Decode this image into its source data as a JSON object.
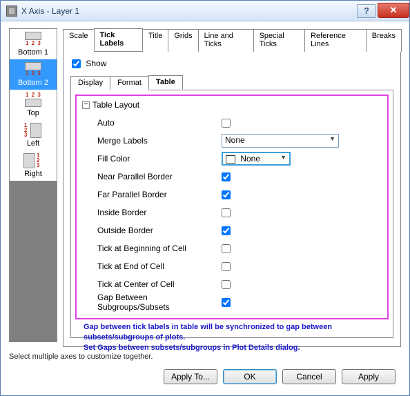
{
  "window": {
    "title": "X Axis - Layer 1"
  },
  "sidebar": {
    "items": [
      {
        "label": "Bottom 1"
      },
      {
        "label": "Bottom 2"
      },
      {
        "label": "Top"
      },
      {
        "label": "Left"
      },
      {
        "label": "Right"
      }
    ]
  },
  "tabs": {
    "scale": "Scale",
    "tickLabels": "Tick Labels",
    "title": "Title",
    "grids": "Grids",
    "lineTicks": "Line and Ticks",
    "specialTicks": "Special Ticks",
    "referenceLines": "Reference Lines",
    "breaks": "Breaks"
  },
  "showLabel": "Show",
  "subtabs": {
    "display": "Display",
    "format": "Format",
    "table": "Table"
  },
  "tableLayout": {
    "header": "Table Layout",
    "auto": "Auto",
    "mergeLabels": "Merge Labels",
    "mergeValue": "None",
    "fillColor": "Fill Color",
    "fillValue": "None",
    "nearParallel": "Near Parallel Border",
    "farParallel": "Far Parallel Border",
    "insideBorder": "Inside Border",
    "outsideBorder": "Outside Border",
    "tickBegin": "Tick at Beginning of Cell",
    "tickEnd": "Tick at End of Cell",
    "tickCenter": "Tick at Center of Cell",
    "gapSubgroups": "Gap Between Subgroups/Subsets",
    "checks": {
      "auto": false,
      "near": true,
      "far": true,
      "inside": false,
      "outside": true,
      "begin": false,
      "end": false,
      "center": false,
      "gap": true
    }
  },
  "note": {
    "line1": "Gap between tick labels in table will be synchronized to gap between subsets/subgroups of plots.",
    "line2": "Set Gaps between subsets/subgroups in Plot Details dialog."
  },
  "footnote": "Select multiple axes to customize together.",
  "buttons": {
    "applyTo": "Apply To...",
    "ok": "OK",
    "cancel": "Cancel",
    "apply": "Apply"
  }
}
